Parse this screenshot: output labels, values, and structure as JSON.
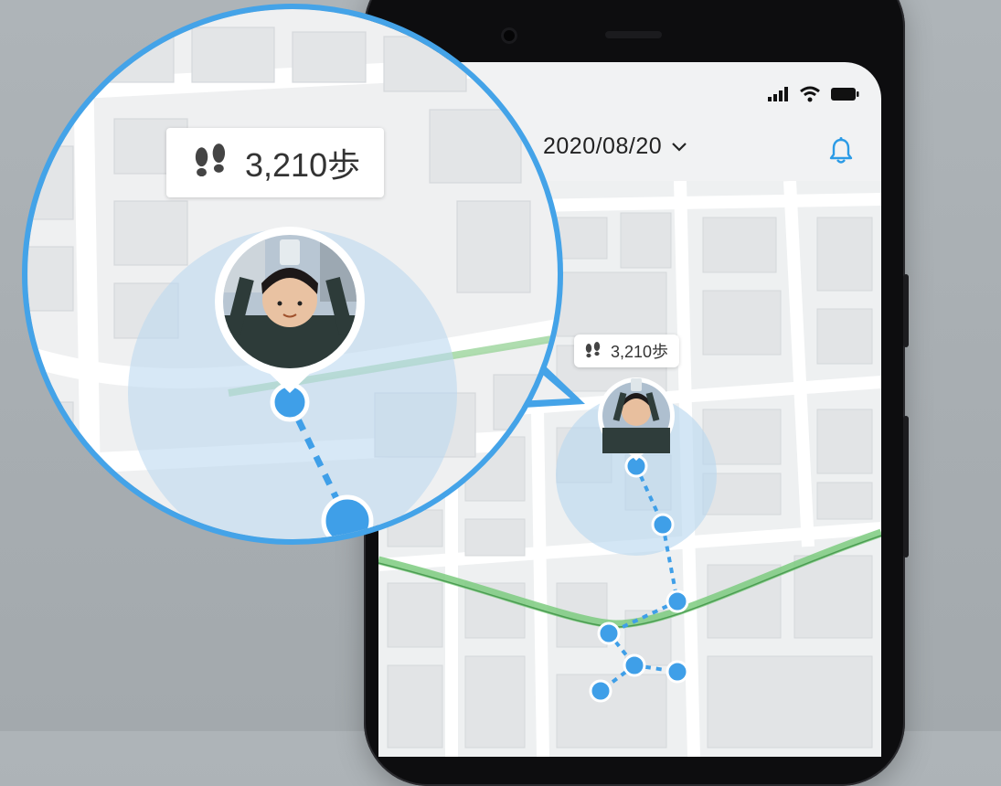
{
  "header": {
    "date": "2020/08/20",
    "date_dropdown_icon": "chevron-down-icon",
    "notification_icon": "bell-icon"
  },
  "status_bar": {
    "icons": [
      "signal-icon",
      "wifi-icon",
      "battery-icon"
    ]
  },
  "map": {
    "steps_label": "3,210歩",
    "steps_icon": "footprints-icon",
    "route_color": "#3f9fe8",
    "accuracy_circle_color": "#bcd9f0"
  },
  "magnifier": {
    "steps_label": "3,210歩",
    "border_color": "#44a3e8"
  },
  "colors": {
    "accent": "#2b9be6",
    "green_path": "#7ccb7f"
  }
}
